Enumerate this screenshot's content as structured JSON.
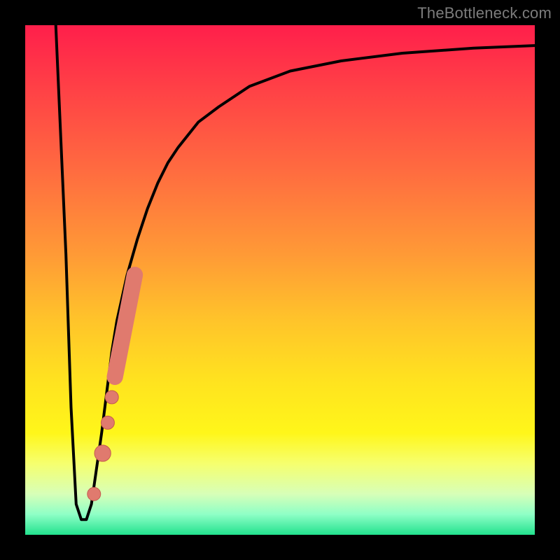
{
  "watermark": "TheBottleneck.com",
  "colors": {
    "curve": "#000000",
    "marker_fill": "#e07a6e",
    "marker_stroke": "#c45b4f"
  },
  "chart_data": {
    "type": "line",
    "title": "",
    "xlabel": "",
    "ylabel": "",
    "xlim": [
      0,
      100
    ],
    "ylim": [
      0,
      100
    ],
    "grid": false,
    "legend": false,
    "annotations": [],
    "series": [
      {
        "name": "curve",
        "x": [
          6,
          8,
          9,
          10,
          11,
          12,
          13,
          15,
          16,
          17,
          18,
          20,
          22,
          24,
          26,
          28,
          30,
          34,
          38,
          44,
          52,
          62,
          74,
          88,
          100
        ],
        "values": [
          100,
          55,
          25,
          6,
          3,
          3,
          6,
          20,
          28,
          36,
          42,
          51,
          58,
          64,
          69,
          73,
          76,
          81,
          84,
          88,
          91,
          93,
          94.5,
          95.5,
          96
        ]
      }
    ],
    "markers": [
      {
        "x": 13.5,
        "y": 8,
        "r": 1.3
      },
      {
        "x": 15.2,
        "y": 16,
        "r": 1.6
      },
      {
        "x": 16.2,
        "y": 22,
        "r": 1.3
      },
      {
        "x": 17.0,
        "y": 27,
        "r": 1.3
      }
    ],
    "thick_segment": {
      "x0": 17.6,
      "y0": 31,
      "x1": 21.5,
      "y1": 51,
      "width": 3.2
    }
  }
}
